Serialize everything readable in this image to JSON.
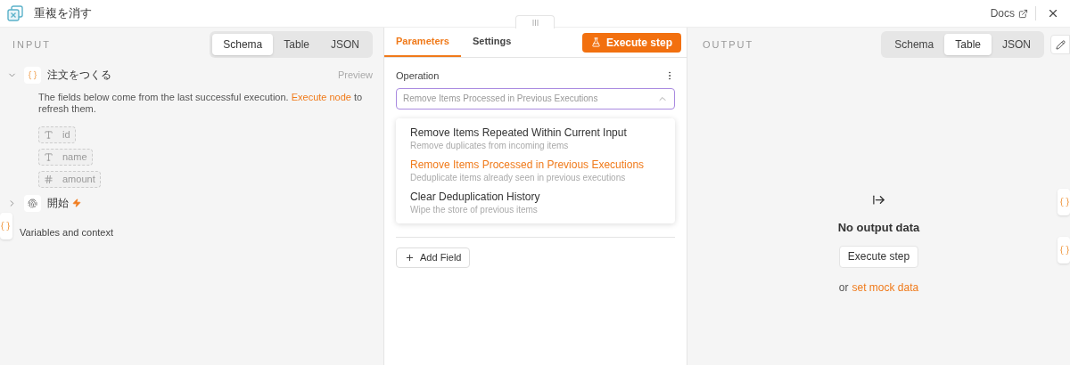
{
  "header": {
    "title": "重複を消す",
    "docs_link": "Docs"
  },
  "input_panel": {
    "label": "INPUT",
    "view_tabs": [
      {
        "label": "Schema",
        "selected": true
      },
      {
        "label": "Table",
        "selected": false
      },
      {
        "label": "JSON",
        "selected": false
      }
    ],
    "nodes": [
      {
        "name": "注文をつくる",
        "kind": "object",
        "expanded": true,
        "preview": "Preview",
        "notice_before": "The fields below come from the last successful execution.",
        "notice_link": "Execute node",
        "notice_after": "to refresh them.",
        "fields": [
          {
            "kind": "text",
            "name": "id"
          },
          {
            "kind": "text",
            "name": "name"
          },
          {
            "kind": "number",
            "name": "amount"
          }
        ]
      },
      {
        "name": "開始",
        "kind": "trigger",
        "expanded": false,
        "trigger": true
      }
    ],
    "variables_label": "Variables and context"
  },
  "parameters_panel": {
    "tabs": [
      {
        "label": "Parameters",
        "selected": true
      },
      {
        "label": "Settings",
        "selected": false
      }
    ],
    "execute_button": "Execute step",
    "operation": {
      "label": "Operation",
      "value": "Remove Items Processed in Previous Executions",
      "expanded": true,
      "options": [
        {
          "title": "Remove Items Repeated Within Current Input",
          "description": "Remove duplicates from incoming items",
          "selected": false
        },
        {
          "title": "Remove Items Processed in Previous Executions",
          "description": "Deduplicate items already seen in previous executions",
          "selected": true
        },
        {
          "title": "Clear Deduplication History",
          "description": "Wipe the store of previous items",
          "selected": false
        }
      ]
    },
    "add_field": "Add Field"
  },
  "output_panel": {
    "label": "OUTPUT",
    "view_tabs": [
      {
        "label": "Schema",
        "selected": false
      },
      {
        "label": "Table",
        "selected": true
      },
      {
        "label": "JSON",
        "selected": false
      }
    ],
    "empty_title": "No output data",
    "execute_button": "Execute step",
    "or_text": "or",
    "mock_link": "set mock data"
  }
}
